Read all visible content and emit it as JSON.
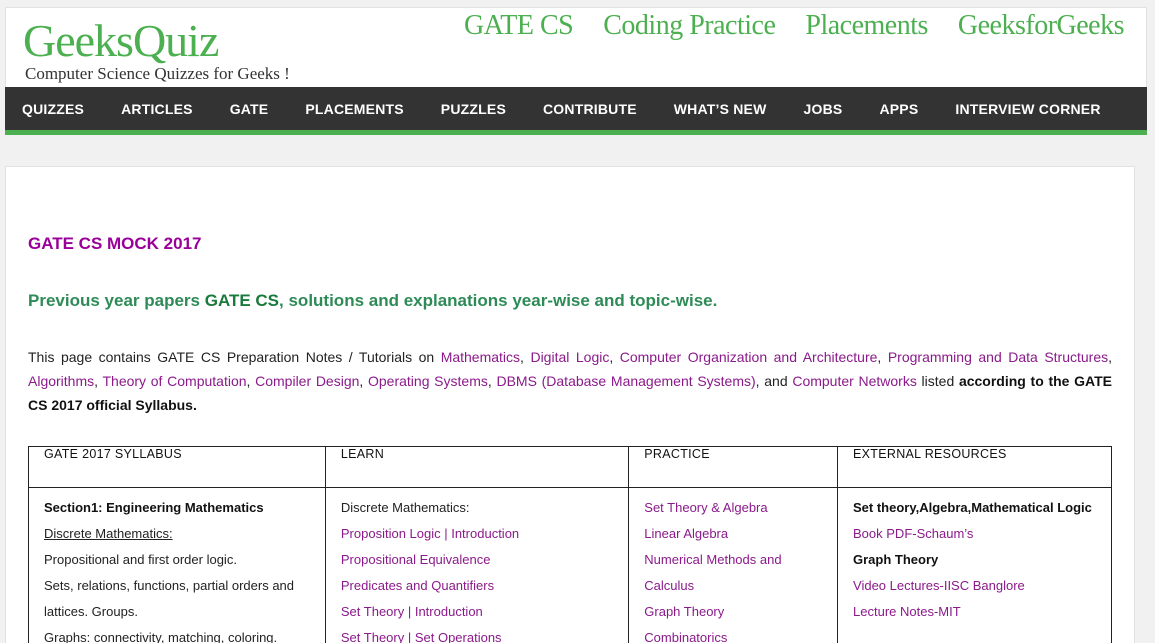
{
  "header": {
    "logo": "GeeksQuiz",
    "tagline": "Computer Science Quizzes for Geeks !",
    "top_links": [
      "GATE CS",
      "Coding Practice",
      "Placements",
      "GeeksforGeeks"
    ]
  },
  "nav": {
    "items": [
      "QUIZZES",
      "ARTICLES",
      "GATE",
      "PLACEMENTS",
      "PUZZLES",
      "CONTRIBUTE",
      "WHAT’S NEW",
      "JOBS",
      "APPS",
      "INTERVIEW CORNER"
    ]
  },
  "main": {
    "mock_title": "GATE CS MOCK 2017",
    "subtitle_pre": "Previous year papers ",
    "subtitle_bold": "GATE CS",
    "subtitle_post": ", solutions and explanations year-wise and topic-wise.",
    "intro_pre": "This page contains GATE CS Preparation Notes / Tutorials on ",
    "intro_links": [
      "Mathematics",
      "Digital Logic",
      "Computer Organization and Architecture",
      "Programming and Data Structures",
      "Algorithms",
      "Theory of Computation",
      "Compiler Design",
      "Operating Systems",
      "DBMS (Database Management Systems)",
      "Computer Networks"
    ],
    "intro_and": "and ",
    "intro_listed": " listed ",
    "intro_bold": "according to the GATE CS 2017 official Syllabus."
  },
  "table": {
    "headers": [
      "GATE 2017 SYLLABUS",
      "LEARN",
      "PRACTICE",
      "EXTERNAL RESOURCES"
    ],
    "syllabus": {
      "section": "Section1: Engineering Mathematics",
      "discrete": "Discrete Mathematics:",
      "line1": "Propositional and first order logic.",
      "line2": "Sets, relations, functions, partial orders and",
      "line3": "lattices. Groups.",
      "graphs": "Graphs",
      "graphs_rest": ": connectivity, matching, coloring."
    },
    "learn": {
      "heading": "Discrete Mathematics:",
      "links": [
        "Proposition Logic | Introduction",
        "Propositional Equivalence",
        "Predicates and Quantifiers",
        "Set Theory | Introduction",
        "Set Theory | Set Operations"
      ]
    },
    "practice": {
      "links": [
        "Set Theory & Algebra",
        "Linear Algebra",
        "Numerical Methods and",
        "Calculus",
        "Graph Theory",
        "Combinatorics"
      ]
    },
    "external": {
      "heading1": "Set theory,Algebra,Mathematical Logic",
      "link1": "Book PDF-Schaum’s",
      "heading2": "Graph Theory",
      "link2": "Video Lectures-IISC Banglore",
      "link3": "Lecture Notes-MIT"
    }
  }
}
